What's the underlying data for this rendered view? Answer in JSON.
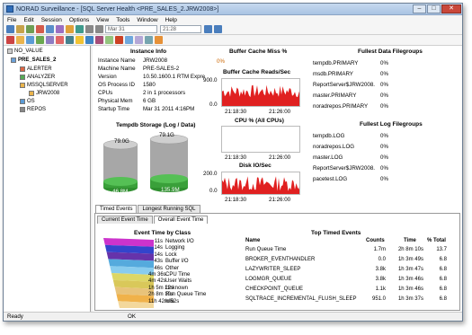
{
  "window": {
    "title": "NORAD  Surveillance - [SQL Server Health <PRE_SALES_2.JRW2008>]"
  },
  "menu": [
    "File",
    "Edit",
    "Session",
    "Options",
    "View",
    "Tools",
    "Window",
    "Help"
  ],
  "toolbar": {
    "date": "Mar 31",
    "time": "21:28"
  },
  "tree": {
    "root": "NO_VALUE",
    "server": "PRE_SALES_2",
    "items": [
      "ALERTER",
      "ANALYZER",
      "MSSQLSERVER",
      "JRW2008",
      "OS",
      "REPOS"
    ]
  },
  "instance": {
    "heading": "Instance Info",
    "rows": [
      {
        "k": "Instance Name",
        "v": "JRW2008"
      },
      {
        "k": "Machine Name",
        "v": "PRE-SALES-2"
      },
      {
        "k": "Version",
        "v": "10.50.1600.1 RTM Expre"
      },
      {
        "k": "OS Process ID",
        "v": "1580"
      },
      {
        "k": "CPUs",
        "v": "2 in 1 processors"
      },
      {
        "k": "Physical Mem",
        "v": "6 GB"
      },
      {
        "k": "Startup Time",
        "v": "Mar 31 2011  4:16PM"
      }
    ]
  },
  "tempdb": {
    "heading": "Tempdb Storage (Log / Data)",
    "log": {
      "total": "79.0G",
      "used": "46.8M"
    },
    "data": {
      "total": "79.1G",
      "used": "135.9M"
    }
  },
  "buffer_miss": {
    "heading": "Buffer Cache Miss %",
    "value": "0%"
  },
  "charts": {
    "reads": {
      "title": "Buffer Cache Reads/Sec",
      "ymax": "900.0",
      "ymin": "0.0",
      "x1": "21:18:30",
      "x2": "21:26:00"
    },
    "cpu": {
      "title": "CPU % (All CPUs)",
      "x1": "21:18:30",
      "x2": "21:26:00"
    },
    "disk": {
      "title": "Disk IO/Sec",
      "ymax": "200.0",
      "ymin": "0.0",
      "x1": "21:18:30",
      "x2": "21:26:00"
    }
  },
  "fullest_data": {
    "heading": "Fullest Data Filegroups",
    "rows": [
      {
        "name": "tempdb.PRIMARY",
        "pct": "0%"
      },
      {
        "name": "msdb.PRIMARY",
        "pct": "0%"
      },
      {
        "name": "ReportServer$JRW2008.",
        "pct": "0%"
      },
      {
        "name": "master.PRIMARY",
        "pct": "0%"
      },
      {
        "name": "noradrepos.PRIMARY",
        "pct": "0%"
      }
    ]
  },
  "fullest_log": {
    "heading": "Fullest Log Filegroups",
    "rows": [
      {
        "name": "tempdb.LOG",
        "pct": "0%"
      },
      {
        "name": "noradrepos.LOG",
        "pct": "0%"
      },
      {
        "name": "master.LOG",
        "pct": "0%"
      },
      {
        "name": "ReportServer$JRW2008.",
        "pct": "0%"
      },
      {
        "name": "pacetest.LOG",
        "pct": "0%"
      }
    ]
  },
  "tabs": {
    "outer": [
      "Timed Events",
      "Longest Running SQL"
    ],
    "inner": [
      "Current Event Time",
      "Overall Event Time"
    ]
  },
  "events": {
    "heading": "Event Time by Class",
    "rows": [
      {
        "time": "11s",
        "label": "Network I/O",
        "color": "#cc33cc"
      },
      {
        "time": "14s",
        "label": "Logging",
        "color": "#3344cc"
      },
      {
        "time": "14s",
        "label": "Lock",
        "color": "#6633aa"
      },
      {
        "time": "43s",
        "label": "Buffer I/O",
        "color": "#55aadd"
      },
      {
        "time": "46s",
        "label": "Other",
        "color": "#88ccee"
      },
      {
        "time": "4m 36s",
        "label": "CPU Time",
        "color": "#ddd766"
      },
      {
        "time": "4m 42s",
        "label": "User Waits",
        "color": "#d9c85a"
      },
      {
        "time": "1h 5m 22s",
        "label": "Unknown",
        "color": "#e8c37a"
      },
      {
        "time": "2h 8m 10s",
        "label": "Run Queue Time",
        "color": "#f0b24a"
      },
      {
        "time": "11h 42m 52s",
        "label": "Idle",
        "color": "#f3d89c"
      }
    ]
  },
  "top_timed": {
    "heading": "Top Timed Events",
    "columns": [
      "Name",
      "Counts",
      "Time",
      "% Total"
    ],
    "rows": [
      {
        "name": "Run Queue Time",
        "counts": "1.7m",
        "time": "2h 8m 10s",
        "pct": "13.7"
      },
      {
        "name": "BROKER_EVENTHANDLER",
        "counts": "0.0",
        "time": "1h 3m 49s",
        "pct": "6.8"
      },
      {
        "name": "LAZYWRITER_SLEEP",
        "counts": "3.8k",
        "time": "1h 3m 47s",
        "pct": "6.8"
      },
      {
        "name": "LOGMGR_QUEUE",
        "counts": "3.8k",
        "time": "1h 3m 46s",
        "pct": "6.8"
      },
      {
        "name": "CHECKPOINT_QUEUE",
        "counts": "1.1k",
        "time": "1h 3m 46s",
        "pct": "6.8"
      },
      {
        "name": "SQLTRACE_INCREMENTAL_FLUSH_SLEEP",
        "counts": "951.0",
        "time": "1h 3m 37s",
        "pct": "6.8"
      }
    ]
  },
  "status": {
    "left": "Ready",
    "right": "OK"
  }
}
